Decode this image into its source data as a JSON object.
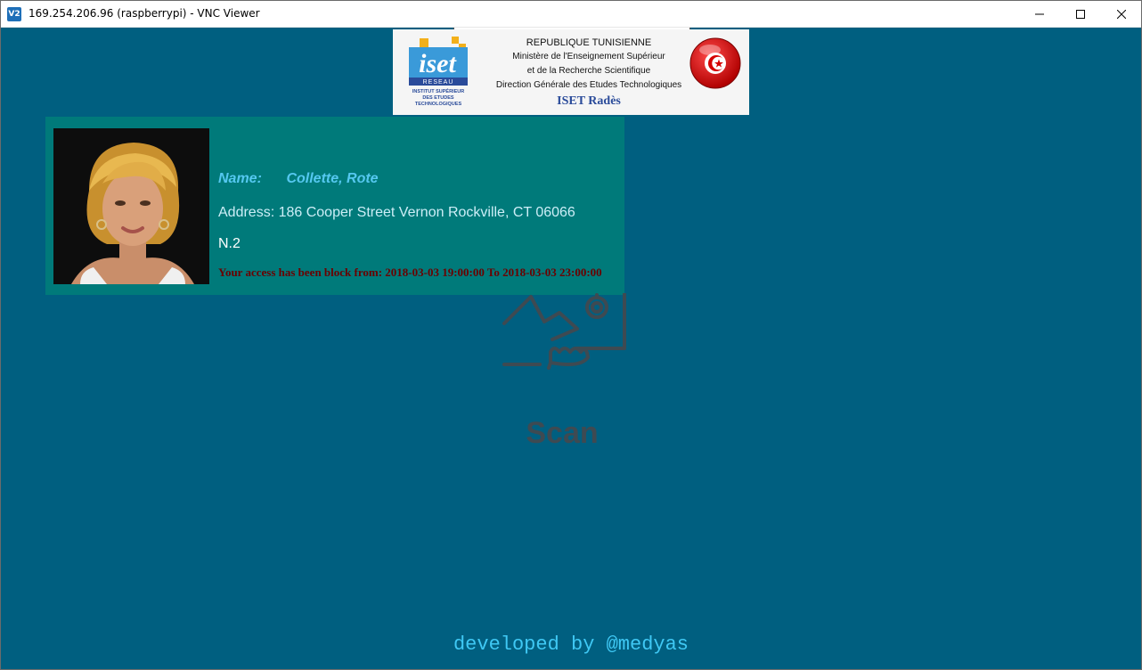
{
  "window": {
    "title": "169.254.206.96 (raspberrypi) - VNC Viewer",
    "app_icon": "V2"
  },
  "banner": {
    "line1": "REPUBLIQUE TUNISIENNE",
    "line2": "Ministère de l'Enseignement Supérieur",
    "line3": "et de la Recherche Scientifique",
    "line4": "Direction Générale des Etudes Technologiques",
    "line5": "ISET Radès",
    "logo_word": "iset",
    "logo_sub": "RESEAU",
    "logo_caption1": "INSTITUT SUPÉRIEUR",
    "logo_caption2": "DES ETUDES",
    "logo_caption3": "TECHNOLOGIQUES"
  },
  "card": {
    "name_label": "Name:",
    "name_value": "Collette, Rote",
    "address": "Address: 186 Cooper Street Vernon Rockville, CT 06066",
    "number": "N.2",
    "access_message": "Your access has been block from: 2018-03-03 19:00:00 To 2018-03-03 23:00:00"
  },
  "scan": {
    "label": "Scan"
  },
  "footer": {
    "text": "developed by @medyas"
  },
  "colors": {
    "background": "#005f80",
    "card": "#007a7a",
    "name": "#55c8f0",
    "footer": "#3fc8f4",
    "alert": "#6a0000"
  }
}
